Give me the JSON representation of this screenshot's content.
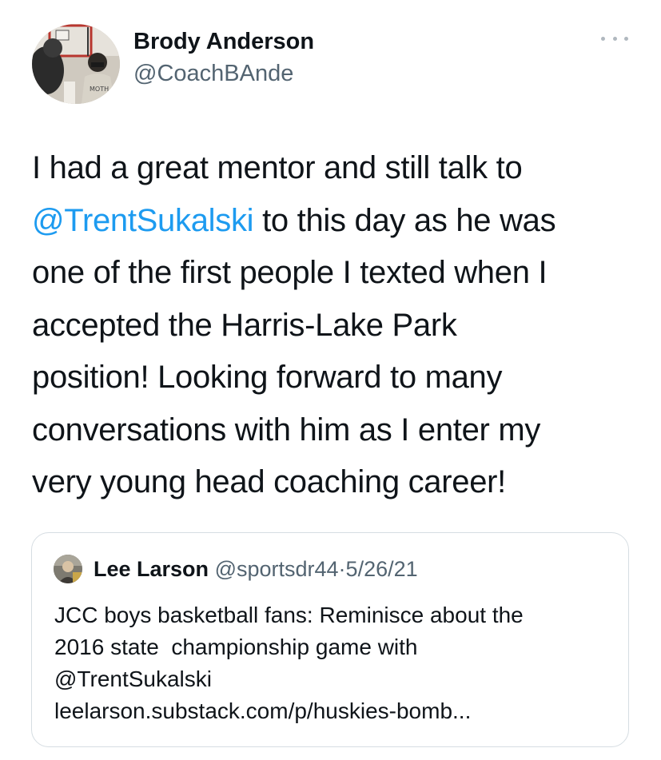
{
  "author": {
    "name": "Brody Anderson",
    "handle": "@CoachBAnde"
  },
  "more_icon": "more-horizontal-icon",
  "tweet": {
    "lines": [
      "I had a great mentor and still talk to",
      "to this day as he was",
      "one of the first people I texted when I",
      "accepted the Harris-Lake Park",
      "position! Looking forward to many",
      "conversations with him as I enter my",
      "very young head coaching career!"
    ],
    "mention": "@TrentSukalski"
  },
  "quoted_tweet": {
    "author_name": "Lee Larson",
    "author_handle": "@sportsdr44",
    "separator": "·",
    "date": "5/26/21",
    "lines": [
      "JCC boys basketball fans: Reminisce about the",
      "2016 state  championship game with",
      "@TrentSukalski",
      "leelarson.substack.com/p/huskies-bomb..."
    ]
  },
  "colors": {
    "link": "#1d9bf0",
    "text": "#0f1419",
    "secondary": "#536471",
    "border": "#d6dde2"
  }
}
